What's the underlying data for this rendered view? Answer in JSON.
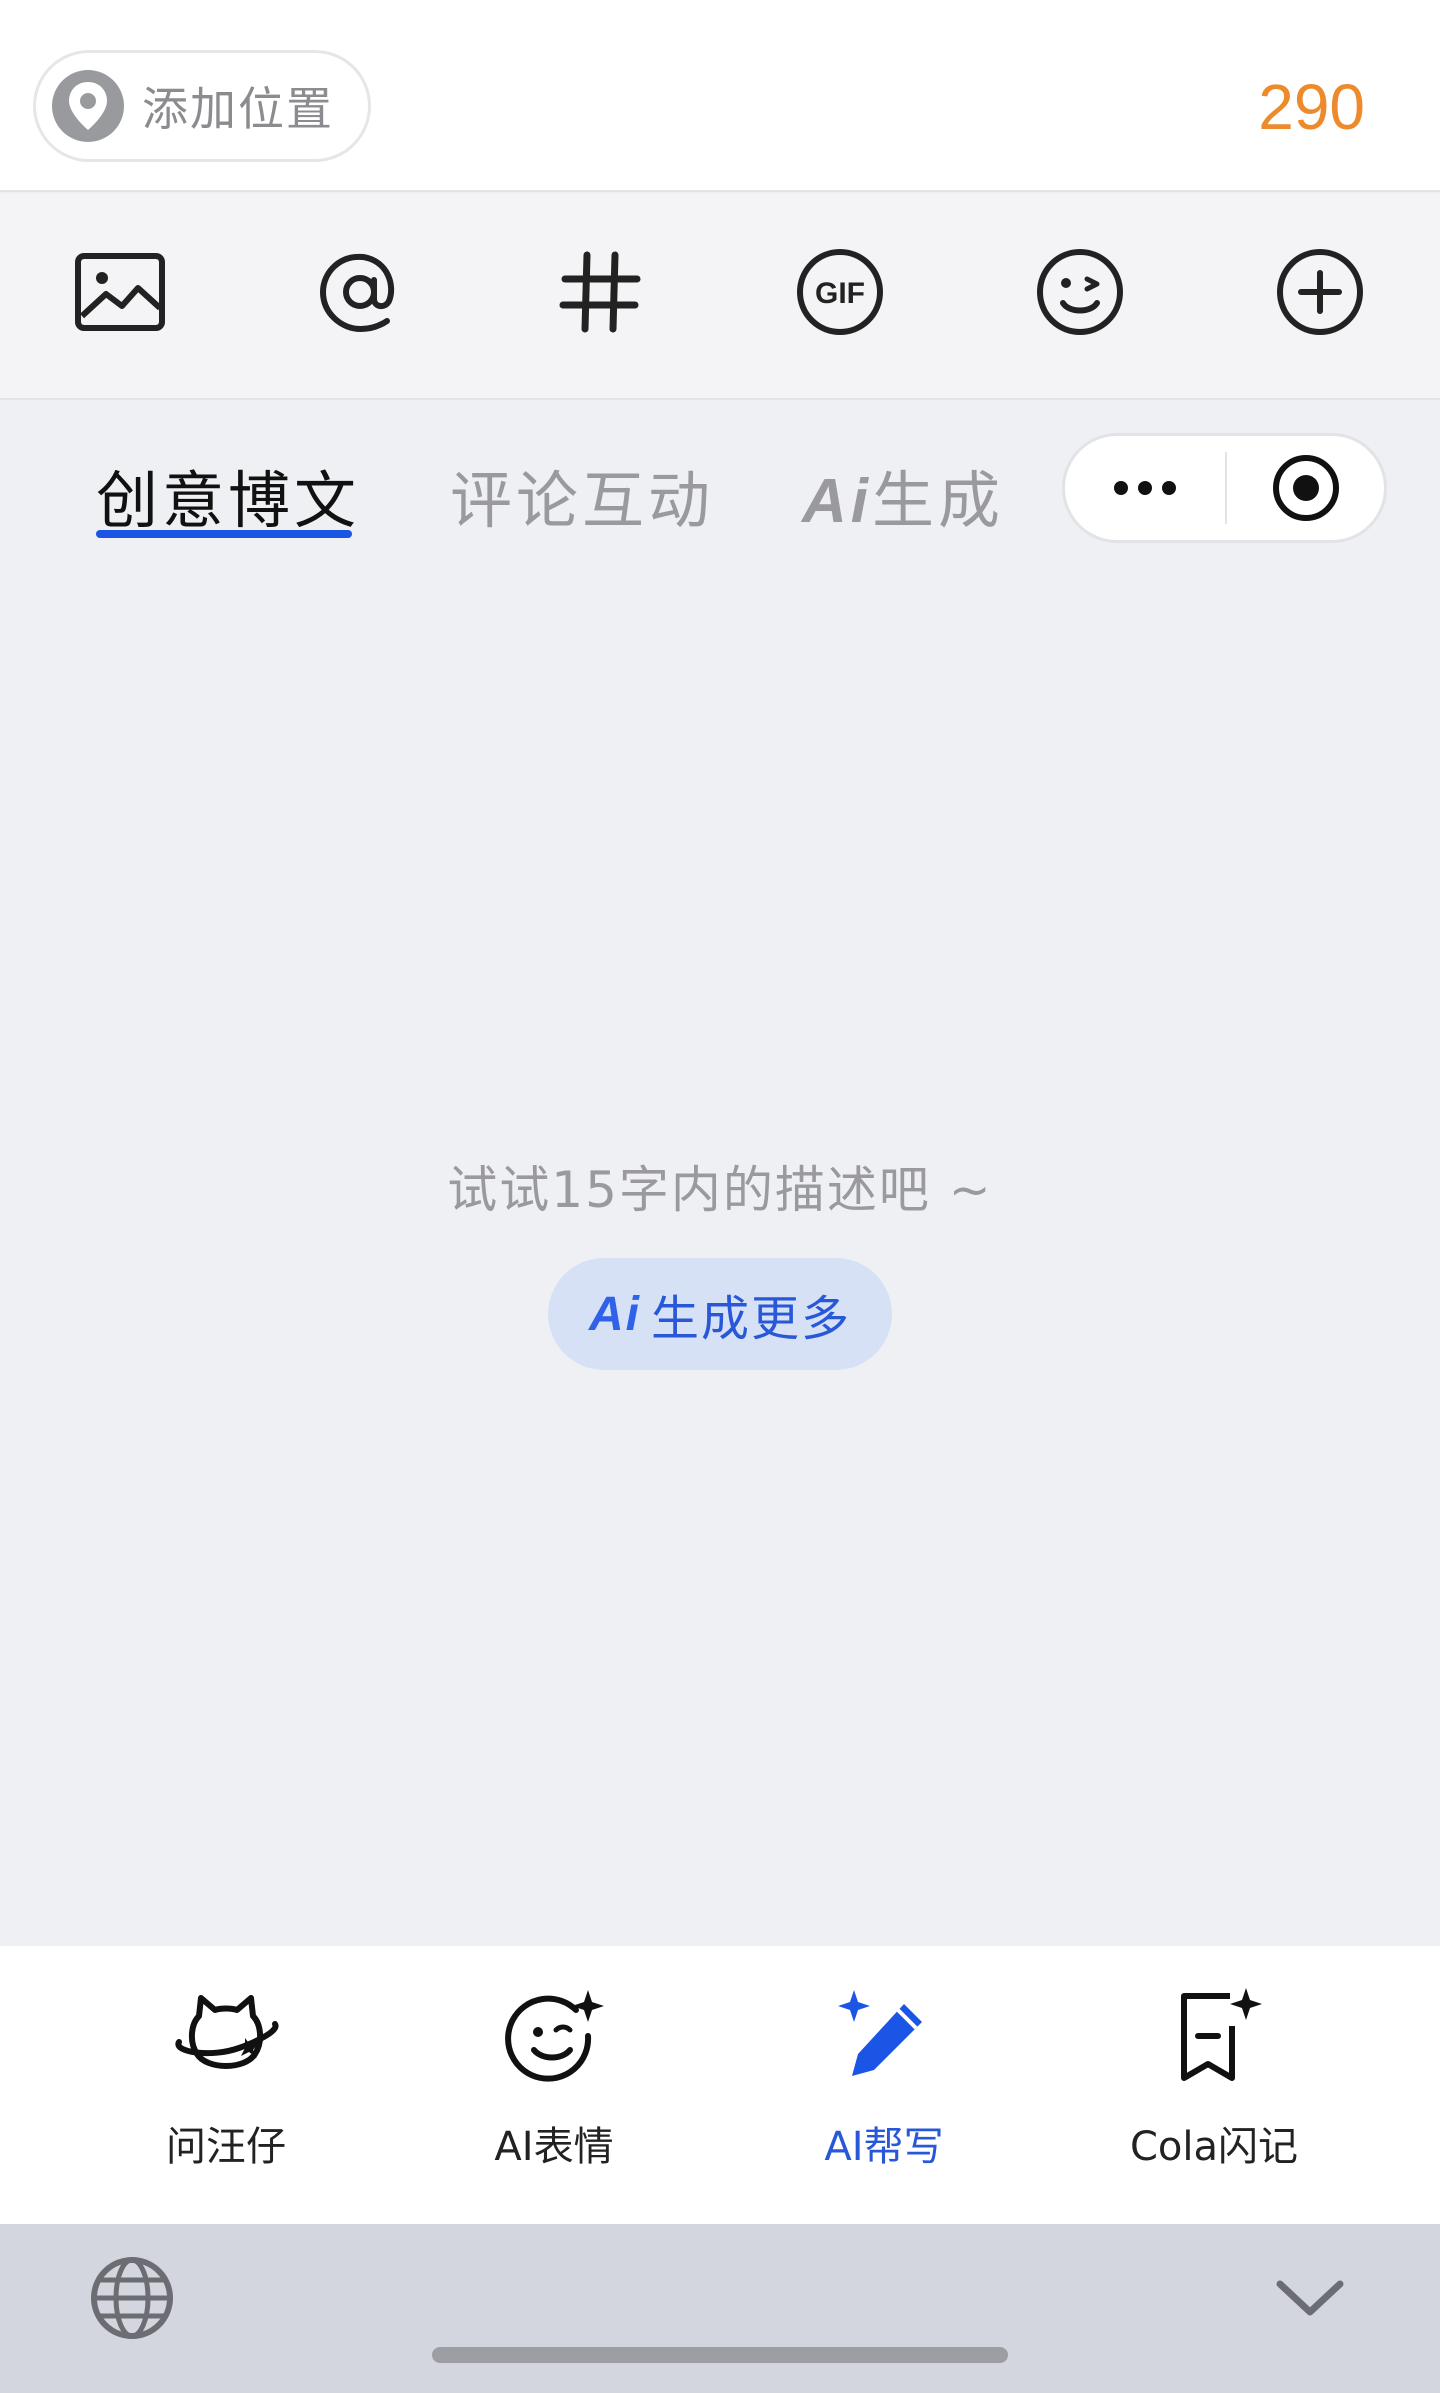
{
  "top_bar": {
    "location_label": "添加位置",
    "char_count": "290"
  },
  "toolbar": {
    "icons": [
      "image-icon",
      "at-icon",
      "hashtag-icon",
      "gif-icon",
      "emoji-icon",
      "add-icon"
    ],
    "gif_text": "GIF"
  },
  "tabs": {
    "items": [
      {
        "label": "创意博文",
        "active": true
      },
      {
        "label": "评论互动",
        "active": false
      },
      {
        "ai": "Ai",
        "label": "生成",
        "active": false
      }
    ]
  },
  "capsule": {
    "icons": [
      "more-icon",
      "record-icon"
    ]
  },
  "empty_state": {
    "hint": "试试15字内的描述吧 ~",
    "button_ai": "Ai",
    "button_label": "生成更多"
  },
  "ai_bar": {
    "items": [
      {
        "label": "问汪仔",
        "icon": "planet-face-icon",
        "active": false
      },
      {
        "label": "AI表情",
        "icon": "sparkle-emoji-icon",
        "active": false
      },
      {
        "label": "AI帮写",
        "icon": "sparkle-pen-icon",
        "active": true
      },
      {
        "label": "Cola闪记",
        "icon": "sparkle-bookmark-icon",
        "active": false
      }
    ]
  },
  "colors": {
    "accent_blue": "#1b55e6",
    "count_orange": "#ec8a2c",
    "button_bg": "#d7e1f6"
  },
  "keyboard_strip": {
    "icons": [
      "globe-icon",
      "chevron-down-icon"
    ]
  }
}
